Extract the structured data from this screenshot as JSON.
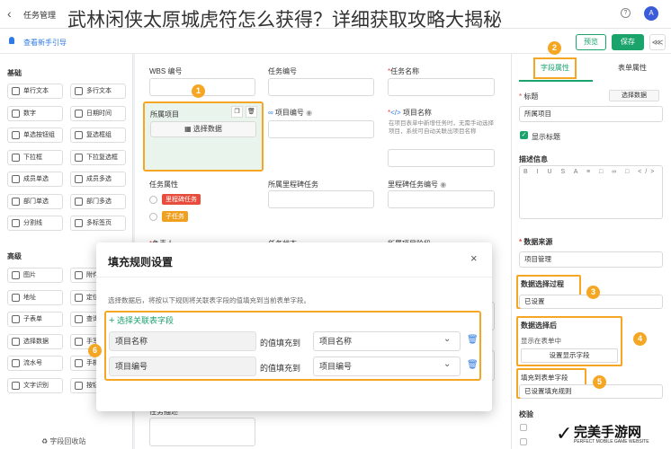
{
  "headline": "武林闲侠太原城虎符怎么获得？详细获取攻略大揭秘",
  "topbar": {
    "back_icon": "chevron-left-icon",
    "title": "任务管理",
    "help_icon": "question-icon",
    "avatar": "A"
  },
  "subbar": {
    "guide": "查看新手引导",
    "preview": "预览",
    "save": "保存"
  },
  "left": {
    "basic_title": "基础",
    "basic": [
      "单行文本",
      "多行文本",
      "数字",
      "日期时间",
      "单选按钮组",
      "复选框组",
      "下拉框",
      "下拉复选框",
      "成员单选",
      "成员多选",
      "部门单选",
      "部门多选",
      "分割线",
      "多标签页"
    ],
    "adv_title": "高级",
    "adv": [
      "图片",
      "附件",
      "地址",
      "定位",
      "子表单",
      "查询",
      "选择数据",
      "手写",
      "流水号",
      "手机",
      "文字识别",
      "按钮"
    ],
    "recycle": "字段回收站"
  },
  "canvas": {
    "wbs": "WBS 编号",
    "task_no": "任务编号",
    "task_name": "任务名称",
    "belong": "所属项目",
    "select_data": "选择数据",
    "proj_no": "项目编号",
    "proj_name": "项目名称",
    "proj_name_hint": "在项目表单中新增任务时，无需手动选择项目，系统可自动关联出项目名称",
    "attr": "任务属性",
    "opt1": "里程碑任务",
    "opt2": "子任务",
    "milestone": "所属里程碑任务",
    "milestone_no": "里程碑任务编号",
    "owner": "负责人",
    "status": "任务状态",
    "stage": "所属项目阶段",
    "bottom_label": "任务描述"
  },
  "modal": {
    "title": "填充规则设置",
    "desc": "选择数据后，将按以下规则将关联表字段的值填充到当前表单字段。",
    "add": "选择关联表字段",
    "rows": [
      {
        "src": "项目名称",
        "mid": "的值填充到",
        "dst": "项目名称"
      },
      {
        "src": "项目编号",
        "mid": "的值填充到",
        "dst": "项目编号"
      }
    ]
  },
  "right": {
    "tab1": "字段属性",
    "tab2": "表单属性",
    "title_label": "标题",
    "select_data_btn": "选择数据",
    "title_value": "所属项目",
    "show_title": "显示标题",
    "desc_label": "描述信息",
    "source_label": "数据来源",
    "source_value": "项目管理",
    "process_label": "数据选择过程",
    "process_value": "已设置",
    "after_label": "数据选择后",
    "after_sub": "显示在表单中",
    "after_btn": "设置显示字段",
    "fill_label": "填充到表单字段",
    "fill_value": "已设置填充规则",
    "verify": "校验"
  },
  "callouts": [
    "1",
    "2",
    "3",
    "4",
    "5",
    "6"
  ],
  "watermark": {
    "name": "完美手游网",
    "sub": "PERFECT MOBILE GAME WEBSITE"
  },
  "colors": {
    "accent": "#1aa36b",
    "callout": "#f5a623",
    "danger": "#e74c3c",
    "blue": "#2f7be5"
  }
}
